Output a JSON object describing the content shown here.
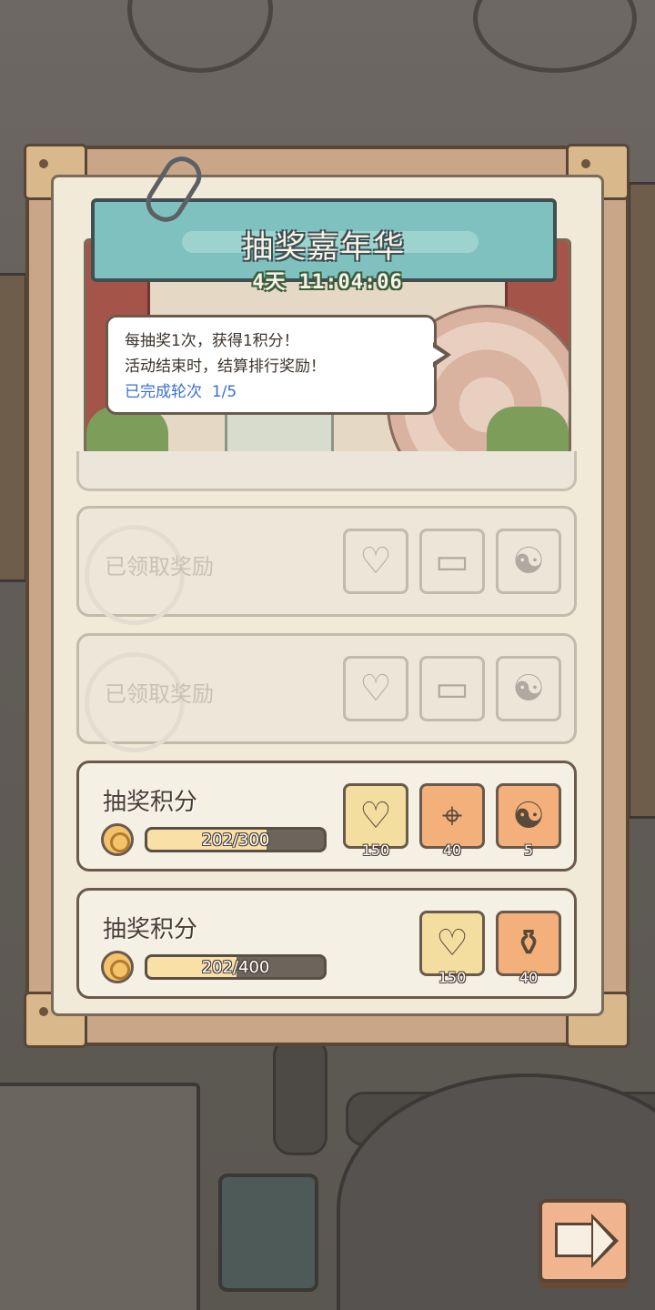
{
  "event": {
    "title": "抽奖嘉年华",
    "countdown": "4天 11:04:06"
  },
  "info_bubble": {
    "line1": "每抽奖1次，获得1积分！",
    "line2": "活动结束时，结算排行奖励！",
    "progress_label": "已完成轮次",
    "progress_value": "1/5"
  },
  "claimed_rows": [
    {
      "label": "已领取奖励",
      "rewards": [
        {
          "icon": "balloon-icon"
        },
        {
          "icon": "ticket-icon"
        },
        {
          "icon": "yin-yang-coin-icon"
        }
      ]
    },
    {
      "label": "已领取奖励",
      "rewards": [
        {
          "icon": "balloon-icon"
        },
        {
          "icon": "ticket-icon"
        },
        {
          "icon": "yin-yang-coin-icon"
        }
      ]
    }
  ],
  "active_rows": [
    {
      "title": "抽奖积分",
      "progress_text": "202/300",
      "progress_fraction": 0.673,
      "rewards": [
        {
          "icon": "balloon-icon",
          "qty": "150",
          "style": "gold"
        },
        {
          "icon": "telescope-icon",
          "qty": "40",
          "style": "orange"
        },
        {
          "icon": "yin-yang-coin-icon",
          "qty": "5",
          "style": "orange"
        }
      ]
    },
    {
      "title": "抽奖积分",
      "progress_text": "202/400",
      "progress_fraction": 0.505,
      "rewards": [
        {
          "icon": "balloon-icon",
          "qty": "150",
          "style": "gold"
        },
        {
          "icon": "vase-icon",
          "qty": "40",
          "style": "orange"
        }
      ]
    }
  ],
  "next_button": {
    "icon": "right-arrow-icon"
  },
  "colors": {
    "frame": "#c9a687",
    "panel": "#f1ead8",
    "banner": "#7ec1be",
    "progress_link": "#3a6fd0",
    "reward_gold": "#f3dea0",
    "reward_orange": "#f4b07a"
  }
}
